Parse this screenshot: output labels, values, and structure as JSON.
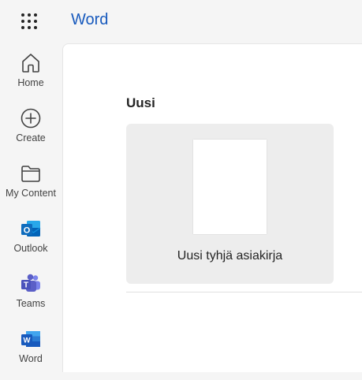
{
  "header": {
    "app_title": "Word",
    "app_launcher_icon": "waffle-grid-icon"
  },
  "rail": {
    "items": [
      {
        "label": "Home",
        "icon": "home-icon"
      },
      {
        "label": "Create",
        "icon": "plus-circle-icon"
      },
      {
        "label": "My Content",
        "icon": "folder-icon"
      },
      {
        "label": "Outlook",
        "icon": "outlook-icon"
      },
      {
        "label": "Teams",
        "icon": "teams-icon"
      },
      {
        "label": "Word",
        "icon": "word-icon"
      }
    ]
  },
  "main": {
    "section_title": "Uusi",
    "templates": [
      {
        "label": "Uusi tyhjä asiakirja",
        "icon": "blank-document-thumbnail"
      }
    ]
  },
  "colors": {
    "brand_word": "#185abd",
    "outlook": "#0f6cbd",
    "teams": "#5b5fc7",
    "background": "#f5f5f5",
    "card": "#ededed"
  }
}
